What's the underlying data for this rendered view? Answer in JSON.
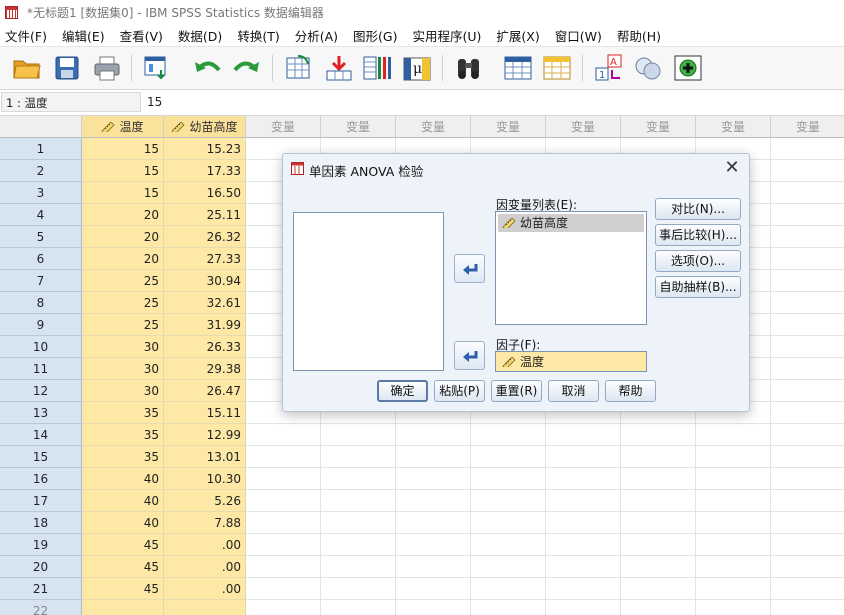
{
  "window": {
    "title": "*无标题1 [数据集0] - IBM SPSS Statistics 数据编辑器"
  },
  "menu": [
    "文件(F)",
    "编辑(E)",
    "查看(V)",
    "数据(D)",
    "转换(T)",
    "分析(A)",
    "图形(G)",
    "实用程序(U)",
    "扩展(X)",
    "窗口(W)",
    "帮助(H)"
  ],
  "toolbar_icons": [
    "open-folder-icon",
    "save-icon",
    "print-icon",
    "dialog-recall-icon",
    "undo-icon",
    "redo-icon",
    "goto-case-icon",
    "goto-variable-icon",
    "variables-icon",
    "value-labels-icon",
    "find-icon",
    "insert-cases-icon",
    "split-file-icon",
    "weight-cases-icon",
    "use-sets-icon",
    "spell-check-icon"
  ],
  "cellbar": {
    "ref": "1 : 温度",
    "value": "15"
  },
  "grid": {
    "columns": [
      "温度",
      "幼苗高度"
    ],
    "var_placeholder": "变量",
    "rows": [
      [
        "15",
        "15.23"
      ],
      [
        "15",
        "17.33"
      ],
      [
        "15",
        "16.50"
      ],
      [
        "20",
        "25.11"
      ],
      [
        "20",
        "26.32"
      ],
      [
        "20",
        "27.33"
      ],
      [
        "25",
        "30.94"
      ],
      [
        "25",
        "32.61"
      ],
      [
        "25",
        "31.99"
      ],
      [
        "30",
        "26.33"
      ],
      [
        "30",
        "29.38"
      ],
      [
        "30",
        "26.47"
      ],
      [
        "35",
        "15.11"
      ],
      [
        "35",
        "12.99"
      ],
      [
        "35",
        "13.01"
      ],
      [
        "40",
        "10.30"
      ],
      [
        "40",
        "5.26"
      ],
      [
        "40",
        "7.88"
      ],
      [
        "45",
        ".00"
      ],
      [
        "45",
        ".00"
      ],
      [
        "45",
        ".00"
      ]
    ],
    "extra_row_number": "22"
  },
  "dialog": {
    "title": "单因素 ANOVA 检验",
    "dependent_label": "因变量列表(E):",
    "dependent_items": [
      "幼苗高度"
    ],
    "factor_label": "因子(F):",
    "factor_value": "温度",
    "side_buttons": [
      "对比(N)...",
      "事后比较(H)...",
      "选项(O)...",
      "自助抽样(B)..."
    ],
    "bottom_buttons": [
      "确定",
      "粘贴(P)",
      "重置(R)",
      "取消",
      "帮助"
    ]
  },
  "colors": {
    "selected_column": "#fde8a6",
    "row_header": "#d6e4f2",
    "dialog_bg": "#eef3fa"
  }
}
